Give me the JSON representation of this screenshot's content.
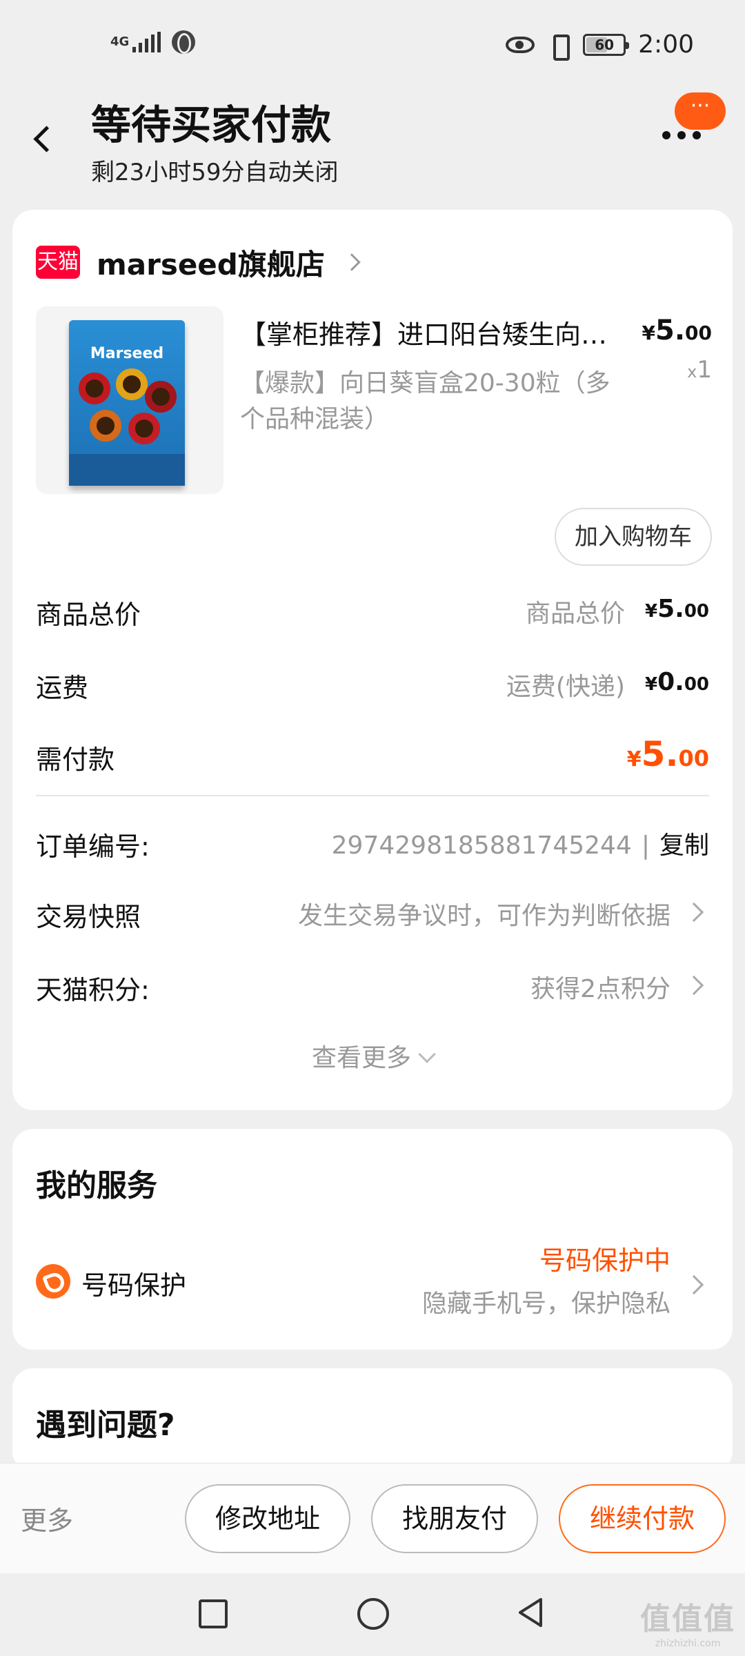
{
  "status_bar": {
    "network": "4G",
    "battery": "60",
    "battery_level": 0.6,
    "time": "2:00",
    "icons": [
      "signal-icon",
      "globe-icon",
      "eye-icon",
      "vibrate-icon",
      "battery-icon"
    ]
  },
  "header": {
    "title": "等待买家付款",
    "subtitle": "剩23小时59分自动关闭",
    "more_badge": "···"
  },
  "store": {
    "logo": "天猫",
    "name": "marseed旗舰店"
  },
  "product": {
    "image_brand": "Marseed",
    "title": "【掌柜推荐】进口阳台矮生向日葵种子",
    "price_currency": "¥",
    "price_int": "5.",
    "price_dec": "00",
    "sku": "【爆款】向日葵盲盒20-30粒（多个品种混装）",
    "qty_prefix": "x",
    "qty": "1",
    "add_to_cart": "加入购物车"
  },
  "price_summary": {
    "rows": [
      {
        "label": "商品总价",
        "sub": "商品总价",
        "currency": "¥",
        "int": "5.",
        "dec": "00"
      },
      {
        "label": "运费",
        "sub": "运费(快递)",
        "currency": "¥",
        "int": "0.",
        "dec": "00"
      },
      {
        "label": "需付款",
        "sub": "",
        "currency": "¥",
        "int": "5.",
        "dec": "00"
      }
    ]
  },
  "order_info": {
    "order_no_label": "订单编号:",
    "order_no": "2974298185881745244",
    "separator": "|",
    "copy": "复制",
    "snapshot_label": "交易快照",
    "snapshot_value": "发生交易争议时，可作为判断依据",
    "points_label": "天猫积分:",
    "points_value": "获得2点积分",
    "see_more": "查看更多"
  },
  "services": {
    "title": "我的服务",
    "item_name": "号码保护",
    "item_status": "号码保护中",
    "item_desc": "隐藏手机号，保护隐私"
  },
  "problem": {
    "title": "遇到问题?"
  },
  "actions": {
    "more": "更多",
    "modify_address": "修改地址",
    "friend_pay": "找朋友付",
    "continue_pay": "继续付款"
  },
  "watermark": {
    "mark": "值值值",
    "url": "zhizhizhi.com"
  },
  "colors": {
    "accent": "#ff5000",
    "tmall_red": "#ff0036",
    "background": "#efefef"
  }
}
